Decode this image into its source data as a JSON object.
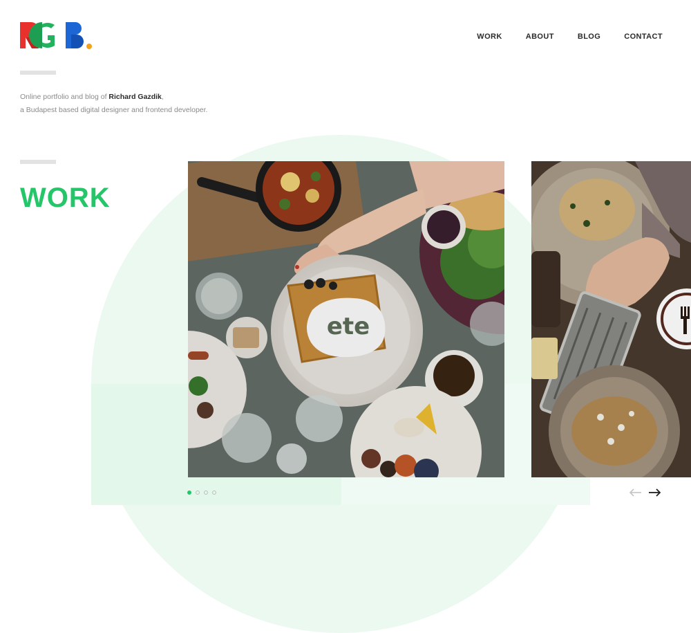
{
  "logo": {
    "text": "RGB.",
    "icon": "rgb-logo",
    "colors": [
      "#e8302c",
      "#22b35e",
      "#1d66d6",
      "#f0a21c"
    ]
  },
  "nav": {
    "items": [
      {
        "label": "WORK"
      },
      {
        "label": "ABOUT"
      },
      {
        "label": "BLOG"
      },
      {
        "label": "CONTACT"
      }
    ]
  },
  "intro": {
    "line1_prefix": "Online portfolio and blog of ",
    "name": "Richard Gazdik",
    "line1_suffix": ",",
    "line2": "a Budapest based digital designer and frontend developer."
  },
  "section": {
    "title": "WORK",
    "accent_color": "#25c66a"
  },
  "projects": [
    {
      "logo_text": "ete",
      "icon": "ete-logo-badge"
    },
    {
      "icon": "fork-icon"
    }
  ],
  "slider": {
    "dots": 4,
    "active_index": 0,
    "prev_icon": "arrow-left-icon",
    "next_icon": "arrow-right-icon"
  }
}
